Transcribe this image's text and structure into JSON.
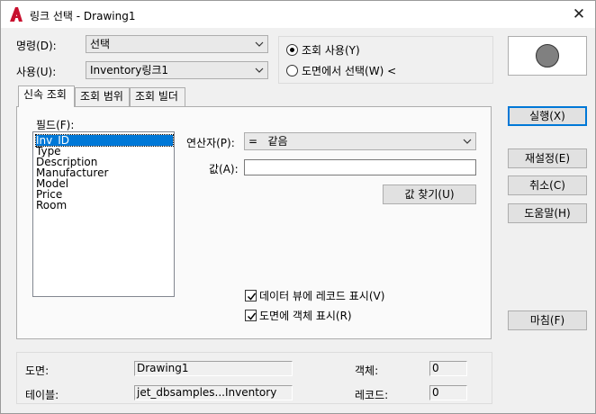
{
  "window": {
    "title": "링크 선택 - Drawing1",
    "close_glyph": "✕"
  },
  "form": {
    "command_label": "명령(D):",
    "command_value": "선택",
    "use_label": "사용(U):",
    "use_value": "Inventory링크1"
  },
  "mode_group": {
    "option_query": "조회 사용(Y)",
    "option_select": "도면에서 선택(W) <",
    "selected": "option_query"
  },
  "tabs": [
    {
      "label": "신속 조회",
      "active": true
    },
    {
      "label": "조회 범위",
      "active": false
    },
    {
      "label": "조회 빌더",
      "active": false
    }
  ],
  "quick_query": {
    "field_label": "필드(F):",
    "fields": [
      "Inv_ID",
      "Type",
      "Description",
      "Manufacturer",
      "Model",
      "Price",
      "Room"
    ],
    "selected_field": "Inv_ID",
    "operator_label": "연산자(P):",
    "operator_value": "=   같음",
    "value_label": "값(A):",
    "value_text": "",
    "find_values_button": "값 찾기(U)",
    "datagrid_checkbox": "데이터 뷰에 레코드 표시(V)",
    "show_objects_checkbox": "도면에 객체 표시(R)"
  },
  "side_buttons": {
    "execute": "실행(X)",
    "reset": "재설정(E)",
    "cancel": "취소(C)",
    "help": "도움말(H)",
    "finish": "마침(F)"
  },
  "footer": {
    "drawing_label": "도면:",
    "drawing_value": "Drawing1",
    "table_label": "테이블:",
    "table_value": "jet_dbsamples...Inventory",
    "objects_label": "객체:",
    "objects_value": "0",
    "records_label": "레코드:",
    "records_value": "0"
  },
  "colors": {
    "accent": "#0078d7",
    "preview_circle": "#808080",
    "app_icon": "#c8102e"
  },
  "icons": {
    "app": "autocad-a-icon",
    "close": "close-icon",
    "dropdown": "chevron-down-icon",
    "check": "checkmark-icon"
  }
}
